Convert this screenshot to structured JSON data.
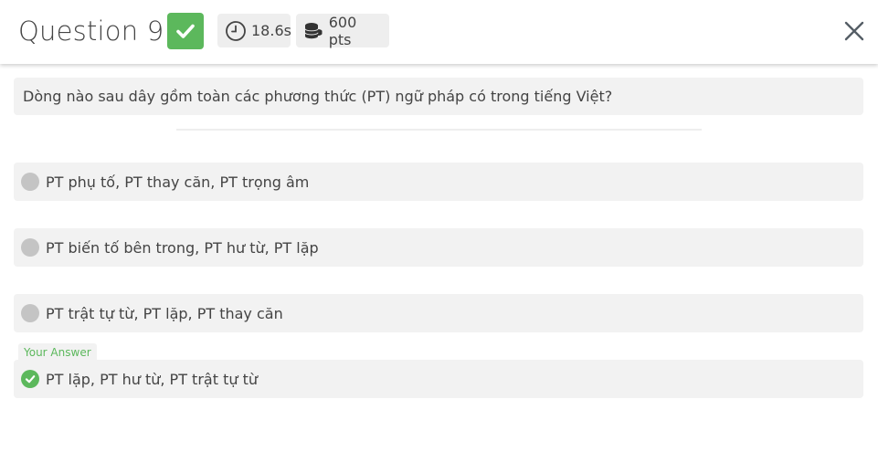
{
  "header": {
    "title": "Question 9",
    "time": "18.6s",
    "points": "600 pts"
  },
  "question": {
    "text": "Dòng nào sau dây gồm toàn các phương thức (PT) ngữ pháp có trong tiếng Việt?"
  },
  "options": [
    {
      "label": "PT phụ tố, PT thay căn, PT trọng âm",
      "selected": false
    },
    {
      "label": "PT biến tố bên trong, PT hư từ, PT lặp",
      "selected": false
    },
    {
      "label": "PT trật tự từ, PT lặp, PT thay căn",
      "selected": false
    },
    {
      "label": "PT lặp, PT hư từ, PT trật tự từ",
      "selected": true
    }
  ],
  "your_answer_label": "Your Answer",
  "colors": {
    "correct": "#5cb85c",
    "option_bg": "#f2f2f2",
    "radio": "#c4c4c4"
  }
}
